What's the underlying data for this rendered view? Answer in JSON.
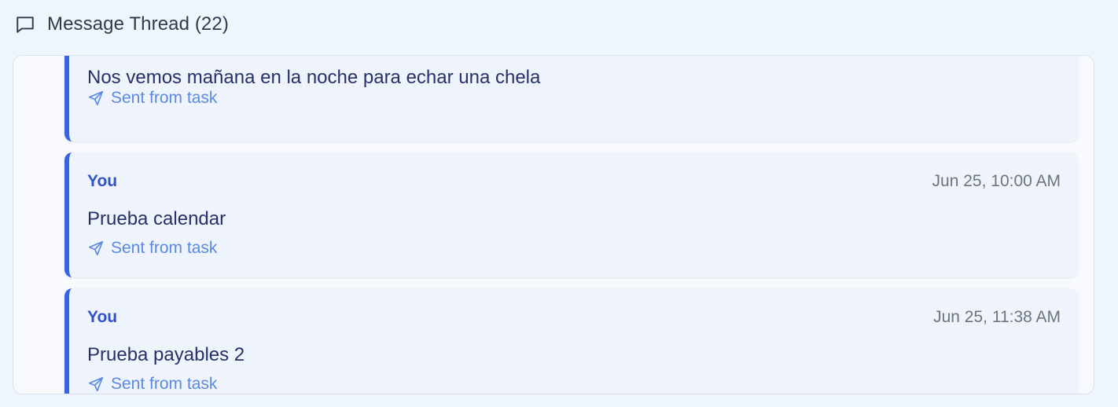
{
  "header": {
    "title": "Message Thread (22)",
    "icon": "message-square-icon"
  },
  "messages": [
    {
      "sender": "",
      "time": "",
      "body": "Nos vemos mañana en la noche para echar una chela",
      "meta": "Sent from task",
      "meta_icon": "send-icon"
    },
    {
      "sender": "You",
      "time": "Jun 25, 10:00 AM",
      "body": "Prueba calendar",
      "meta": "Sent from task",
      "meta_icon": "send-icon"
    },
    {
      "sender": "You",
      "time": "Jun 25, 11:38 AM",
      "body": "Prueba payables 2",
      "meta": "Sent from task",
      "meta_icon": "send-icon"
    }
  ],
  "colors": {
    "accent": "#3563e2",
    "sender": "#3151c9",
    "meta": "#5b8ae0",
    "card_bg": "#eff4fc"
  }
}
